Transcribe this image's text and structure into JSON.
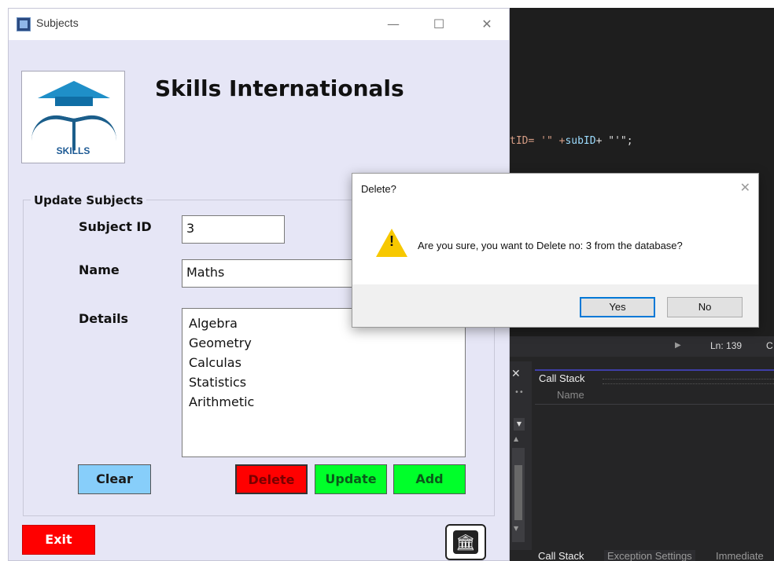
{
  "ide": {
    "code_prefix": "tID= '\" +",
    "code_var": "subID",
    "code_suffix": "+ \"'\";",
    "status_line": "Ln: 139",
    "status_col": "C",
    "call_stack_title": "Call Stack",
    "call_stack_column": "Name",
    "bottom_tabs": [
      "Call Stack",
      "Exception Settings",
      "Immediate"
    ]
  },
  "window": {
    "title": "Subjects",
    "heading": "Skills Internationals",
    "logo_text": "SKILLS",
    "group_title": "Update Subjects",
    "subject_id_label": "Subject ID",
    "subject_id_value": "3",
    "name_label": "Name",
    "name_value": "Maths",
    "details_label": "Details",
    "details_lines": [
      "Algebra",
      "Geometry",
      "Calculas",
      "Statistics",
      "Arithmetic"
    ],
    "buttons": {
      "clear": "Clear",
      "delete": "Delete",
      "update": "Update",
      "add": "Add",
      "exit": "Exit"
    },
    "colors": {
      "background": "#e6e6f6",
      "clear": "#87cefa",
      "delete": "#ff0000",
      "update": "#00ff2a",
      "add": "#00ff2a",
      "exit": "#ff0000"
    }
  },
  "dialog": {
    "title": "Delete?",
    "message": "Are you sure, you want to Delete no: 3 from the database?",
    "yes_label": "Yes",
    "no_label": "No",
    "icon": "warning-icon"
  }
}
